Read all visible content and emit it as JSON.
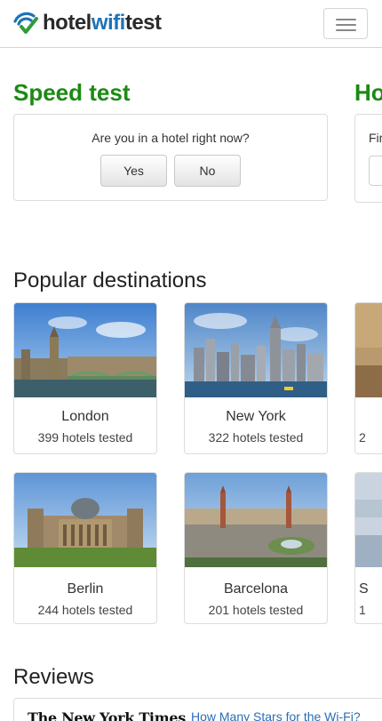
{
  "navbar": {
    "brand_part1": "hotel",
    "brand_part2": "wifi",
    "brand_part3": "test",
    "logo_icon": "wifi-check-logo",
    "menu_icon": "hamburger-icon"
  },
  "speed_test": {
    "heading": "Speed test",
    "question": "Are you in a hotel right now?",
    "yes_label": "Yes",
    "no_label": "No"
  },
  "second_panel": {
    "heading_fragment": "Ho",
    "text_fragment": "Fir"
  },
  "popular": {
    "heading": "Popular destinations",
    "cities": [
      {
        "name": "London",
        "hotels": "399 hotels tested"
      },
      {
        "name": "New York",
        "hotels": "322 hotels tested"
      },
      {
        "name": "Berlin",
        "hotels": "244 hotels tested"
      },
      {
        "name": "Barcelona",
        "hotels": "201 hotels tested"
      }
    ],
    "partial_subtitle_top": "2",
    "partial_name_bottom": "S",
    "partial_subtitle_bottom": "1"
  },
  "reviews": {
    "heading": "Reviews",
    "source": "The New York Times",
    "link_text": "How Many Stars for the Wi-Fi?"
  },
  "colors": {
    "accent_green": "#1c8a14",
    "brand_blue": "#1f73b7",
    "link_blue": "#2a6db5"
  }
}
